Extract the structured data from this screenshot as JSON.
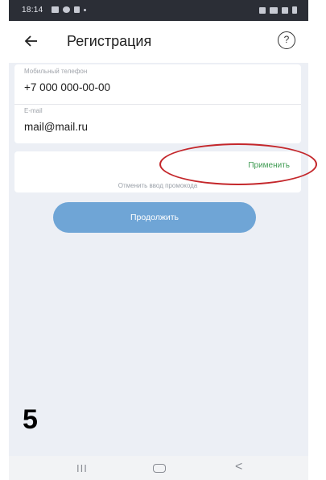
{
  "status_bar": {
    "time": "18:14",
    "left_icons": [
      "gallery-icon",
      "whatsapp-icon",
      "navigation-icon",
      "dot-icon"
    ],
    "right_icons": [
      "vibrate-icon",
      "wifi-icon",
      "signal-icon",
      "battery-icon"
    ]
  },
  "header": {
    "title": "Регистрация",
    "back_icon": "arrow-left-icon",
    "help_label": "?"
  },
  "form": {
    "phone": {
      "label": "Мобильный телефон",
      "value": "+7 000 000-00-00"
    },
    "email": {
      "label": "E-mail",
      "value": "mail@mail.ru"
    }
  },
  "promo": {
    "apply_label": "Применить",
    "cancel_label": "Отменить ввод промокода"
  },
  "continue_label": "Продолжить",
  "step_number": "5",
  "nav": {
    "recent_label": "III",
    "home_icon": "home-circle-icon",
    "back_label": "<"
  },
  "colors": {
    "accent_button": "#6fa5d6",
    "apply_link": "#3f9b52",
    "annotation": "#c4272b",
    "background": "#eceff5"
  }
}
